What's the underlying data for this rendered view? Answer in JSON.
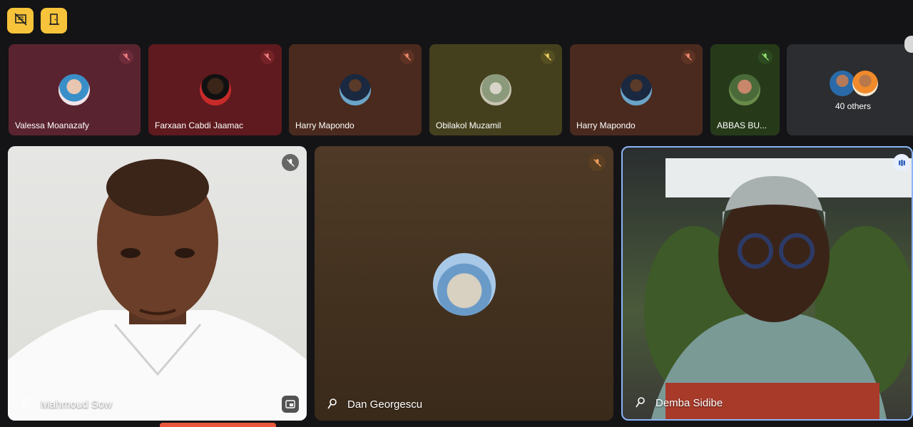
{
  "toolbar": {
    "btn1_icon": "hide-tiles-icon",
    "btn2_icon": "door-exit-icon",
    "accent": "#f7c33a"
  },
  "strip": [
    {
      "name": "Valessa Moanazafy",
      "bg": "#5a2330"
    },
    {
      "name": "Farxaan Cabdi Jaamac",
      "bg": "#5e1a1e"
    },
    {
      "name": "Harry Mapondo",
      "bg": "#4a2a1e"
    },
    {
      "name": "Obilakol Muzamil",
      "bg": "#44401e"
    },
    {
      "name": "Harry Mapondo",
      "bg": "#4a2a1e"
    },
    {
      "name": "ABBAS BU...",
      "bg": "#263a1a"
    }
  ],
  "others": {
    "label": "40 others"
  },
  "main": [
    {
      "name": "Mahmoud Sow"
    },
    {
      "name": "Dan Georgescu"
    },
    {
      "name": "Demba Sidibe"
    }
  ]
}
